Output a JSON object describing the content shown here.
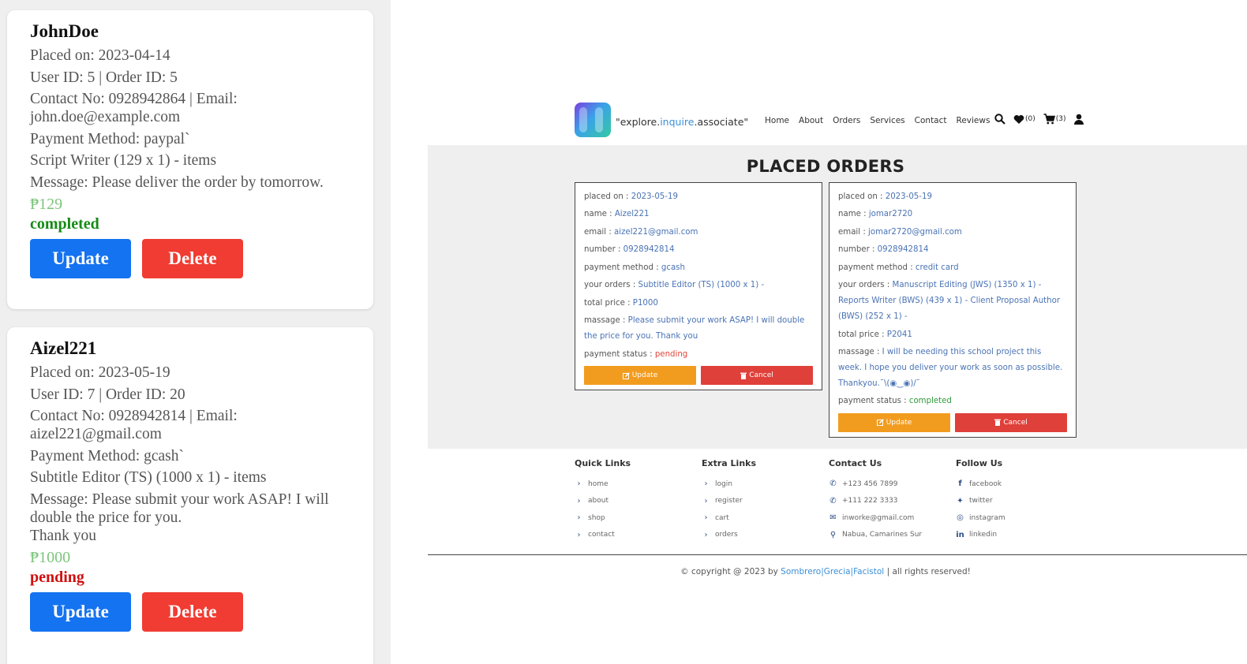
{
  "admin": {
    "orders": [
      {
        "name": "JohnDoe",
        "placed": "Placed on: 2023-04-14",
        "ids": "User ID: 5 | Order ID: 5",
        "contact": "Contact No: 0928942864 | Email: john.doe@example.com",
        "payment": "Payment Method: paypal`",
        "items": "Script Writer (129 x 1) - items",
        "message": "Message: Please deliver the order by tomorrow.",
        "price": "₱129",
        "status": "completed",
        "update_label": "Update",
        "delete_label": "Delete"
      },
      {
        "name": "Aizel221",
        "placed": "Placed on: 2023-05-19",
        "ids": "User ID: 7 | Order ID: 20",
        "contact": "Contact No: 0928942814 | Email: aizel221@gmail.com",
        "payment": "Payment Method: gcash`",
        "items": "Subtitle Editor (TS) (1000 x 1) - items",
        "message": "Message: Please submit your work ASAP! I will double the price for you.",
        "message2": "Thank you",
        "price": "₱1000",
        "status": "pending",
        "update_label": "Update",
        "delete_label": "Delete"
      }
    ]
  },
  "site": {
    "tagline_pre": "\"explore.",
    "tagline_hl": "inquire",
    "tagline_post": ".associate\"",
    "nav": [
      "Home",
      "About",
      "Orders",
      "Services",
      "Contact",
      "Reviews"
    ],
    "wishlist_count": "(0)",
    "cart_count": "(3)",
    "page_title": "PLACED ORDERS",
    "orders": [
      {
        "placed_label": "placed on : ",
        "placed": "2023-05-19",
        "name_label": "name : ",
        "name": "Aizel221",
        "email_label": "email : ",
        "email": "aizel221@gmail.com",
        "number_label": "number : ",
        "number": "0928942814",
        "method_label": "payment method : ",
        "method": "gcash",
        "orders_label": "your orders : ",
        "orders": "Subtitle Editor (TS) (1000 x 1) -",
        "total_label": "total price : ",
        "total": "P1000",
        "msg_label": "massage : ",
        "msg": "Please submit your work ASAP! I will double the price for you. Thank you",
        "status_label": "payment status : ",
        "status": "pending",
        "update_label": "Update",
        "cancel_label": "Cancel"
      },
      {
        "placed_label": "placed on : ",
        "placed": "2023-05-19",
        "name_label": "name : ",
        "name": "jomar2720",
        "email_label": "email : ",
        "email": "jomar2720@gmail.com",
        "number_label": "number : ",
        "number": "0928942814",
        "method_label": "payment method : ",
        "method": "credit card",
        "orders_label": "your orders : ",
        "orders": "Manuscript Editing (JWS) (1350 x 1) - Reports Writer (BWS) (439 x 1) - Client Proposal Author (BWS) (252 x 1) -",
        "total_label": "total price : ",
        "total": "P2041",
        "msg_label": "massage : ",
        "msg": "I will be needing this school project this week. I hope you deliver your work as soon as possible. Thankyou.¯\\(◉‿◉)/¯",
        "status_label": "payment status : ",
        "status": "completed",
        "update_label": "Update",
        "cancel_label": "Cancel"
      }
    ],
    "footer": {
      "quick": {
        "title": "Quick Links",
        "items": [
          "home",
          "about",
          "shop",
          "contact"
        ]
      },
      "extra": {
        "title": "Extra Links",
        "items": [
          "login",
          "register",
          "cart",
          "orders"
        ]
      },
      "contact": {
        "title": "Contact Us",
        "items": [
          "+123 456 7899",
          "+111 222 3333",
          "inworke@gmail.com",
          "Nabua, Camarines Sur"
        ]
      },
      "follow": {
        "title": "Follow Us",
        "items": [
          "facebook",
          "twitter",
          "instagram",
          "linkedin"
        ]
      },
      "copy_pre": "© copyright @ 2023 by ",
      "copy_hl": "Sombrero|Grecia|Facistol",
      "copy_post": " | all rights reserved!"
    }
  }
}
